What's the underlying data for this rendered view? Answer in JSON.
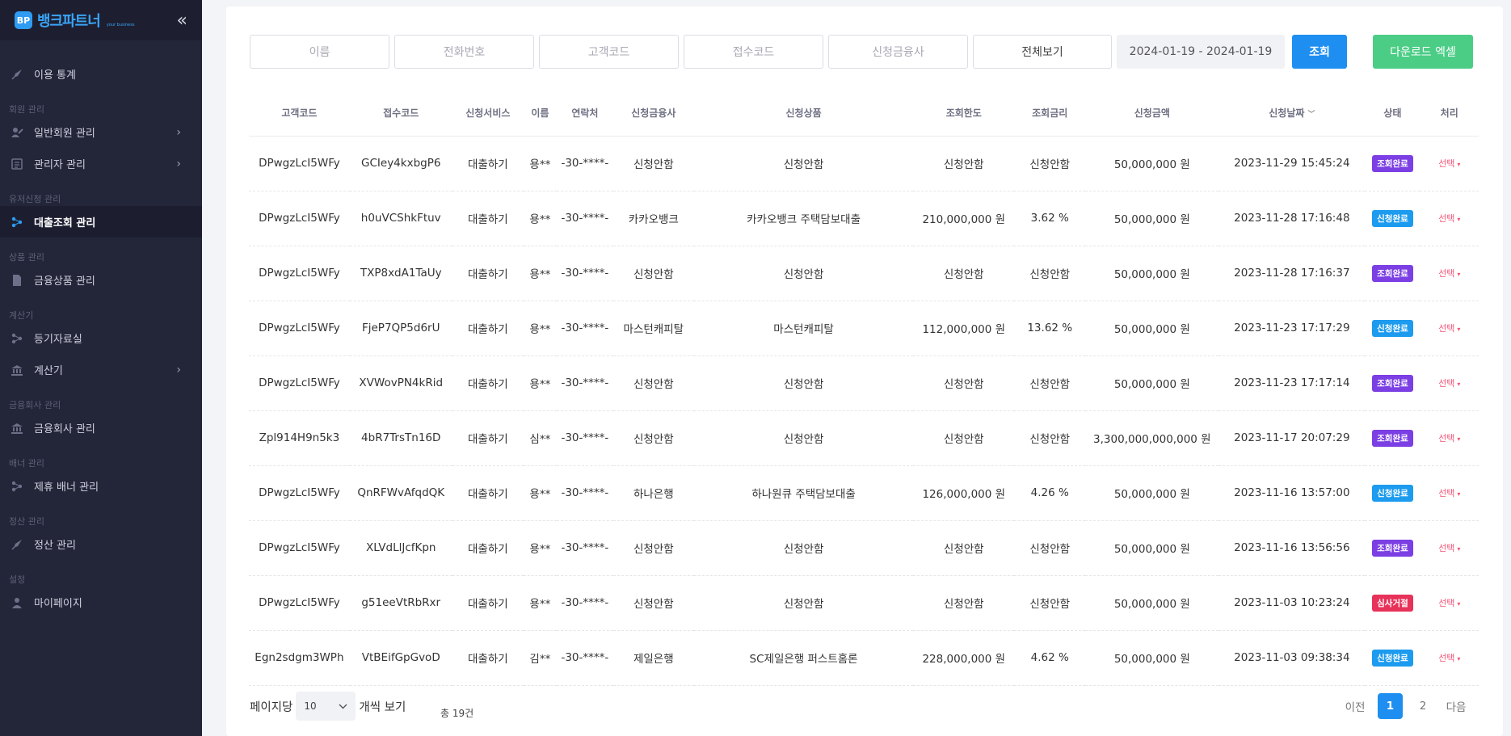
{
  "brand": {
    "mark": "BP",
    "name": "뱅크파트너",
    "sub": "your business"
  },
  "sidebar": {
    "groups": [
      {
        "label": "",
        "items": [
          {
            "label": "이용 통계",
            "icon": "rocket-icon",
            "chevron": false,
            "active": false
          }
        ]
      },
      {
        "label": "회원 관리",
        "items": [
          {
            "label": "일반회원 관리",
            "icon": "user-edit-icon",
            "chevron": true,
            "active": false
          },
          {
            "label": "관리자 관리",
            "icon": "list-icon",
            "chevron": true,
            "active": false
          }
        ]
      },
      {
        "label": "유저신청 관리",
        "items": [
          {
            "label": "대출조회 관리",
            "icon": "nodes-icon",
            "chevron": false,
            "active": true
          }
        ]
      },
      {
        "label": "상품 관리",
        "items": [
          {
            "label": "금융상품 관리",
            "icon": "file-icon",
            "chevron": false,
            "active": false
          }
        ]
      },
      {
        "label": "계산기",
        "items": [
          {
            "label": "등기자료실",
            "icon": "nodes-icon",
            "chevron": false,
            "active": false
          },
          {
            "label": "계산기",
            "icon": "bank-icon",
            "chevron": true,
            "active": false
          }
        ]
      },
      {
        "label": "금융회사 관리",
        "items": [
          {
            "label": "금융회사 관리",
            "icon": "bank-icon",
            "chevron": false,
            "active": false
          }
        ]
      },
      {
        "label": "배너 관리",
        "items": [
          {
            "label": "제휴 배너 관리",
            "icon": "nodes-icon",
            "chevron": false,
            "active": false
          }
        ]
      },
      {
        "label": "정산 관리",
        "items": [
          {
            "label": "정산 관리",
            "icon": "rocket-icon",
            "chevron": false,
            "active": false
          }
        ]
      },
      {
        "label": "설정",
        "items": [
          {
            "label": "마이페이지",
            "icon": "user-icon",
            "chevron": false,
            "active": false
          }
        ]
      }
    ]
  },
  "filters": {
    "name_placeholder": "이름",
    "phone_placeholder": "전화번호",
    "customer_code_placeholder": "고객코드",
    "receipt_code_placeholder": "접수코드",
    "company_placeholder": "신청금융사",
    "view_select": "전체보기",
    "date_range": "2024-01-19 - 2024-01-19",
    "search_label": "조회",
    "excel_label": "다운로드 엑셀"
  },
  "table": {
    "headers": [
      "고객코드",
      "접수코드",
      "신청서비스",
      "이름",
      "연락처",
      "신청금융사",
      "신청상품",
      "조회한도",
      "조회금리",
      "신청금액",
      "신청날짜",
      "상태",
      "처리"
    ],
    "sort_column_index": 10,
    "action_label": "선택",
    "status_colors": {
      "조회완료": "#7b3fe4",
      "신청완료": "#1c9bef",
      "심사거절": "#e7325a"
    },
    "rows": [
      [
        "DPwgzLcI5WFy",
        "GCIey4kxbgP6",
        "대출하기",
        "용**",
        "-30-****-",
        "신청안함",
        "신청안함",
        "신청안함",
        "신청안함",
        "50,000,000 원",
        "2023-11-29 15:45:24",
        "조회완료"
      ],
      [
        "DPwgzLcI5WFy",
        "h0uVCShkFtuv",
        "대출하기",
        "용**",
        "-30-****-",
        "카카오뱅크",
        "카카오뱅크 주택담보대출",
        "210,000,000 원",
        "3.62 %",
        "50,000,000 원",
        "2023-11-28 17:16:48",
        "신청완료"
      ],
      [
        "DPwgzLcI5WFy",
        "TXP8xdA1TaUy",
        "대출하기",
        "용**",
        "-30-****-",
        "신청안함",
        "신청안함",
        "신청안함",
        "신청안함",
        "50,000,000 원",
        "2023-11-28 17:16:37",
        "조회완료"
      ],
      [
        "DPwgzLcI5WFy",
        "FjeP7QP5d6rU",
        "대출하기",
        "용**",
        "-30-****-",
        "마스턴캐피탈",
        "마스턴캐피탈",
        "112,000,000 원",
        "13.62 %",
        "50,000,000 원",
        "2023-11-23 17:17:29",
        "신청완료"
      ],
      [
        "DPwgzLcI5WFy",
        "XVWovPN4kRid",
        "대출하기",
        "용**",
        "-30-****-",
        "신청안함",
        "신청안함",
        "신청안함",
        "신청안함",
        "50,000,000 원",
        "2023-11-23 17:17:14",
        "조회완료"
      ],
      [
        "Zpl914H9n5k3",
        "4bR7TrsTn16D",
        "대출하기",
        "심**",
        "-30-****-",
        "신청안함",
        "신청안함",
        "신청안함",
        "신청안함",
        "3,300,000,000,000 원",
        "2023-11-17 20:07:29",
        "조회완료"
      ],
      [
        "DPwgzLcI5WFy",
        "QnRFWvAfqdQK",
        "대출하기",
        "용**",
        "-30-****-",
        "하나은행",
        "하나원큐 주택담보대출",
        "126,000,000 원",
        "4.26 %",
        "50,000,000 원",
        "2023-11-16 13:57:00",
        "신청완료"
      ],
      [
        "DPwgzLcI5WFy",
        "XLVdLlJcfKpn",
        "대출하기",
        "용**",
        "-30-****-",
        "신청안함",
        "신청안함",
        "신청안함",
        "신청안함",
        "50,000,000 원",
        "2023-11-16 13:56:56",
        "조회완료"
      ],
      [
        "DPwgzLcI5WFy",
        "g51eeVtRbRxr",
        "대출하기",
        "용**",
        "-30-****-",
        "신청안함",
        "신청안함",
        "신청안함",
        "신청안함",
        "50,000,000 원",
        "2023-11-03 10:23:24",
        "심사거절"
      ],
      [
        "Egn2sdgm3WPh",
        "VtBEifGpGvoD",
        "대출하기",
        "김**",
        "-30-****-",
        "제일은행",
        "SC제일은행 퍼스트홈론",
        "228,000,000 원",
        "4.62 %",
        "50,000,000 원",
        "2023-11-03 09:38:34",
        "신청완료"
      ]
    ]
  },
  "pagination": {
    "per_page_prefix": "페이지당",
    "per_page_value": "10",
    "per_page_suffix": "개씩 보기",
    "total": "총 19건",
    "prev": "이전",
    "pages": [
      "1",
      "2"
    ],
    "current": "1",
    "next": "다음"
  }
}
